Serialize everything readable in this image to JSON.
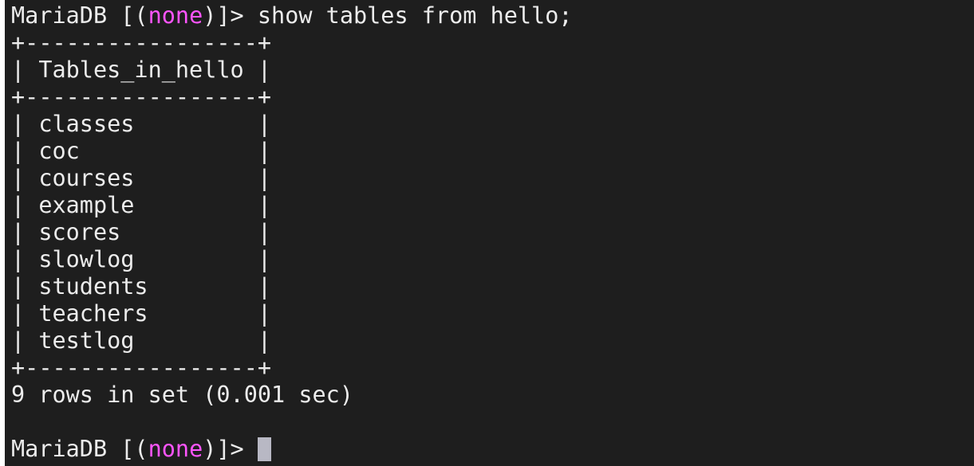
{
  "colors": {
    "background": "#1e1e1e",
    "foreground": "#ececec",
    "prompt_highlight": "#ff55ff",
    "cursor": "#b8b8c4",
    "left_border": "#ffffff"
  },
  "prompt": {
    "prefix": "MariaDB [(",
    "db": "none",
    "suffix": ")]> "
  },
  "command": "show tables from hello;",
  "table": {
    "border": "+-----------------+",
    "header": "| Tables_in_hello |",
    "rows": [
      "| classes         |",
      "| coc             |",
      "| courses         |",
      "| example         |",
      "| scores          |",
      "| slowlog         |",
      "| students        |",
      "| teachers        |",
      "| testlog         |"
    ]
  },
  "result_summary": "9 rows in set (0.001 sec)",
  "blank": "",
  "cursor_icon": "block-cursor"
}
